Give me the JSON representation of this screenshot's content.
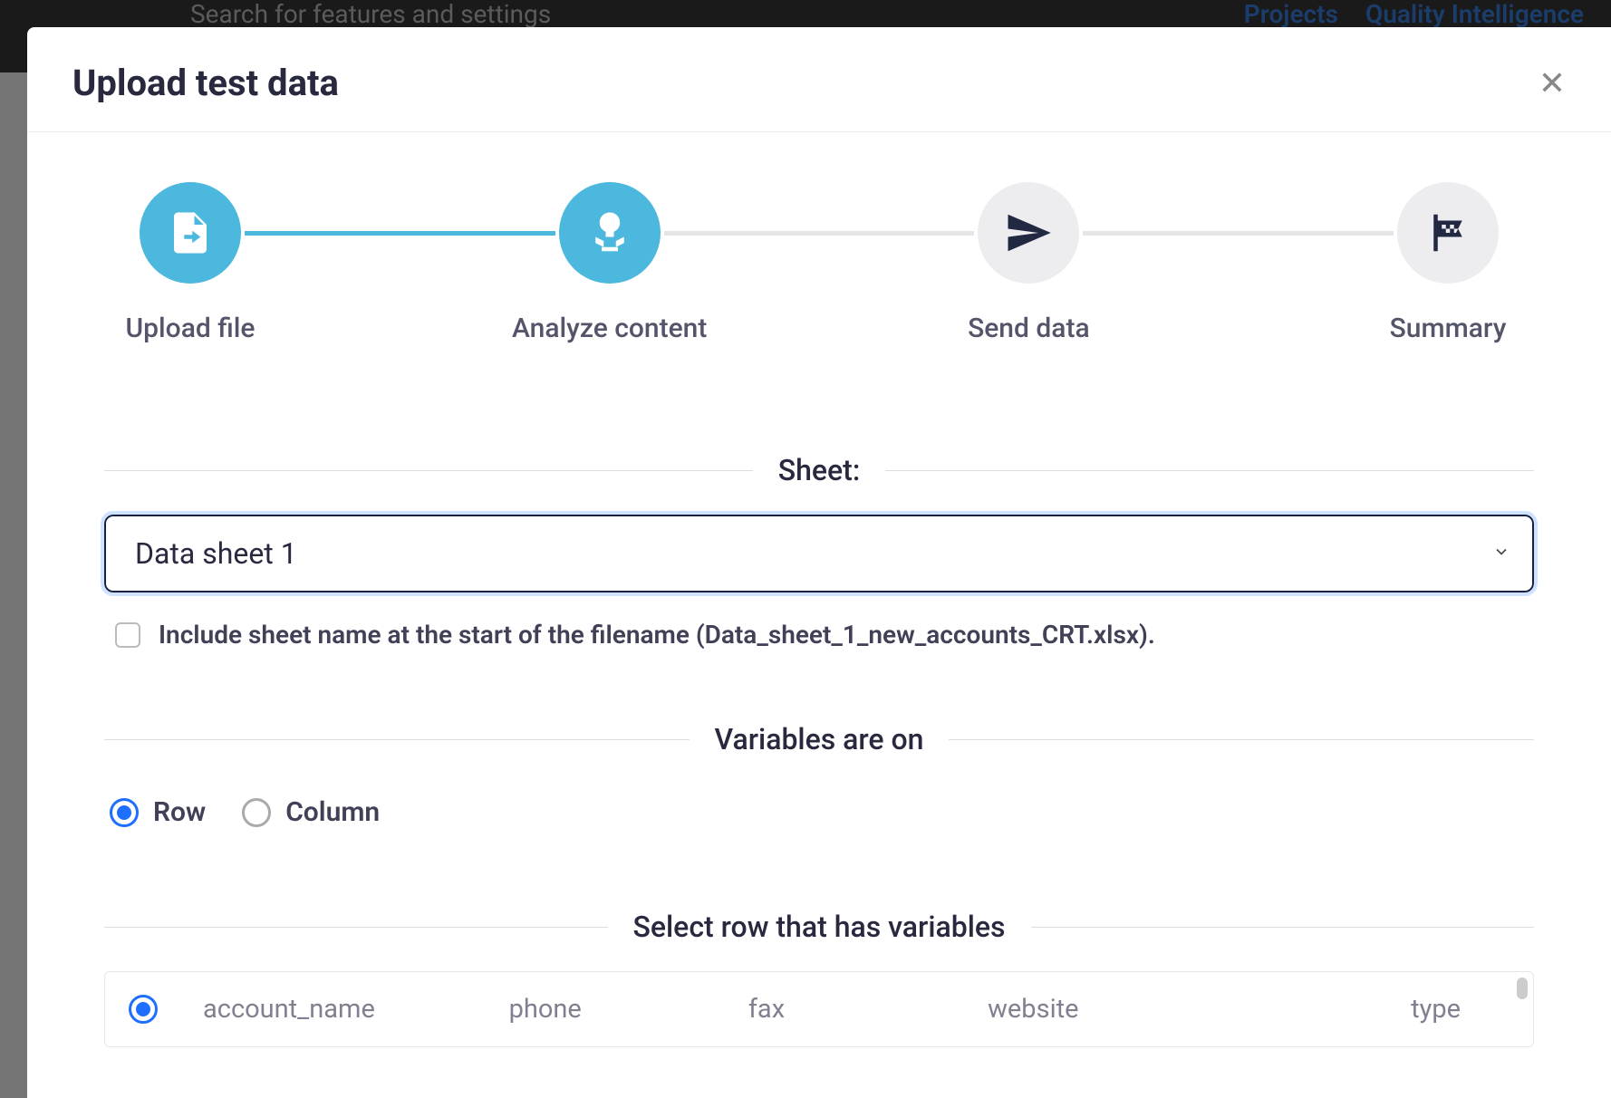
{
  "backdrop": {
    "search_placeholder": "Search for features and settings",
    "nav": [
      "Projects",
      "Quality Intelligence"
    ]
  },
  "modal": {
    "title": "Upload test data",
    "steps": [
      {
        "label": "Upload file",
        "state": "active"
      },
      {
        "label": "Analyze content",
        "state": "active"
      },
      {
        "label": "Send data",
        "state": "inactive"
      },
      {
        "label": "Summary",
        "state": "inactive"
      }
    ],
    "sheet": {
      "section_label": "Sheet:",
      "selected": "Data sheet 1",
      "include_checkbox_label": "Include sheet name at the start of the filename (Data_sheet_1_new_accounts_CRT.xlsx).",
      "include_checked": false
    },
    "variables": {
      "section_label": "Variables are on",
      "options": [
        {
          "label": "Row",
          "checked": true
        },
        {
          "label": "Column",
          "checked": false
        }
      ]
    },
    "select_row": {
      "section_label": "Select row that has variables",
      "rows": [
        {
          "checked": true,
          "cells": [
            "account_name",
            "phone",
            "fax",
            "website",
            "type"
          ]
        }
      ]
    }
  }
}
